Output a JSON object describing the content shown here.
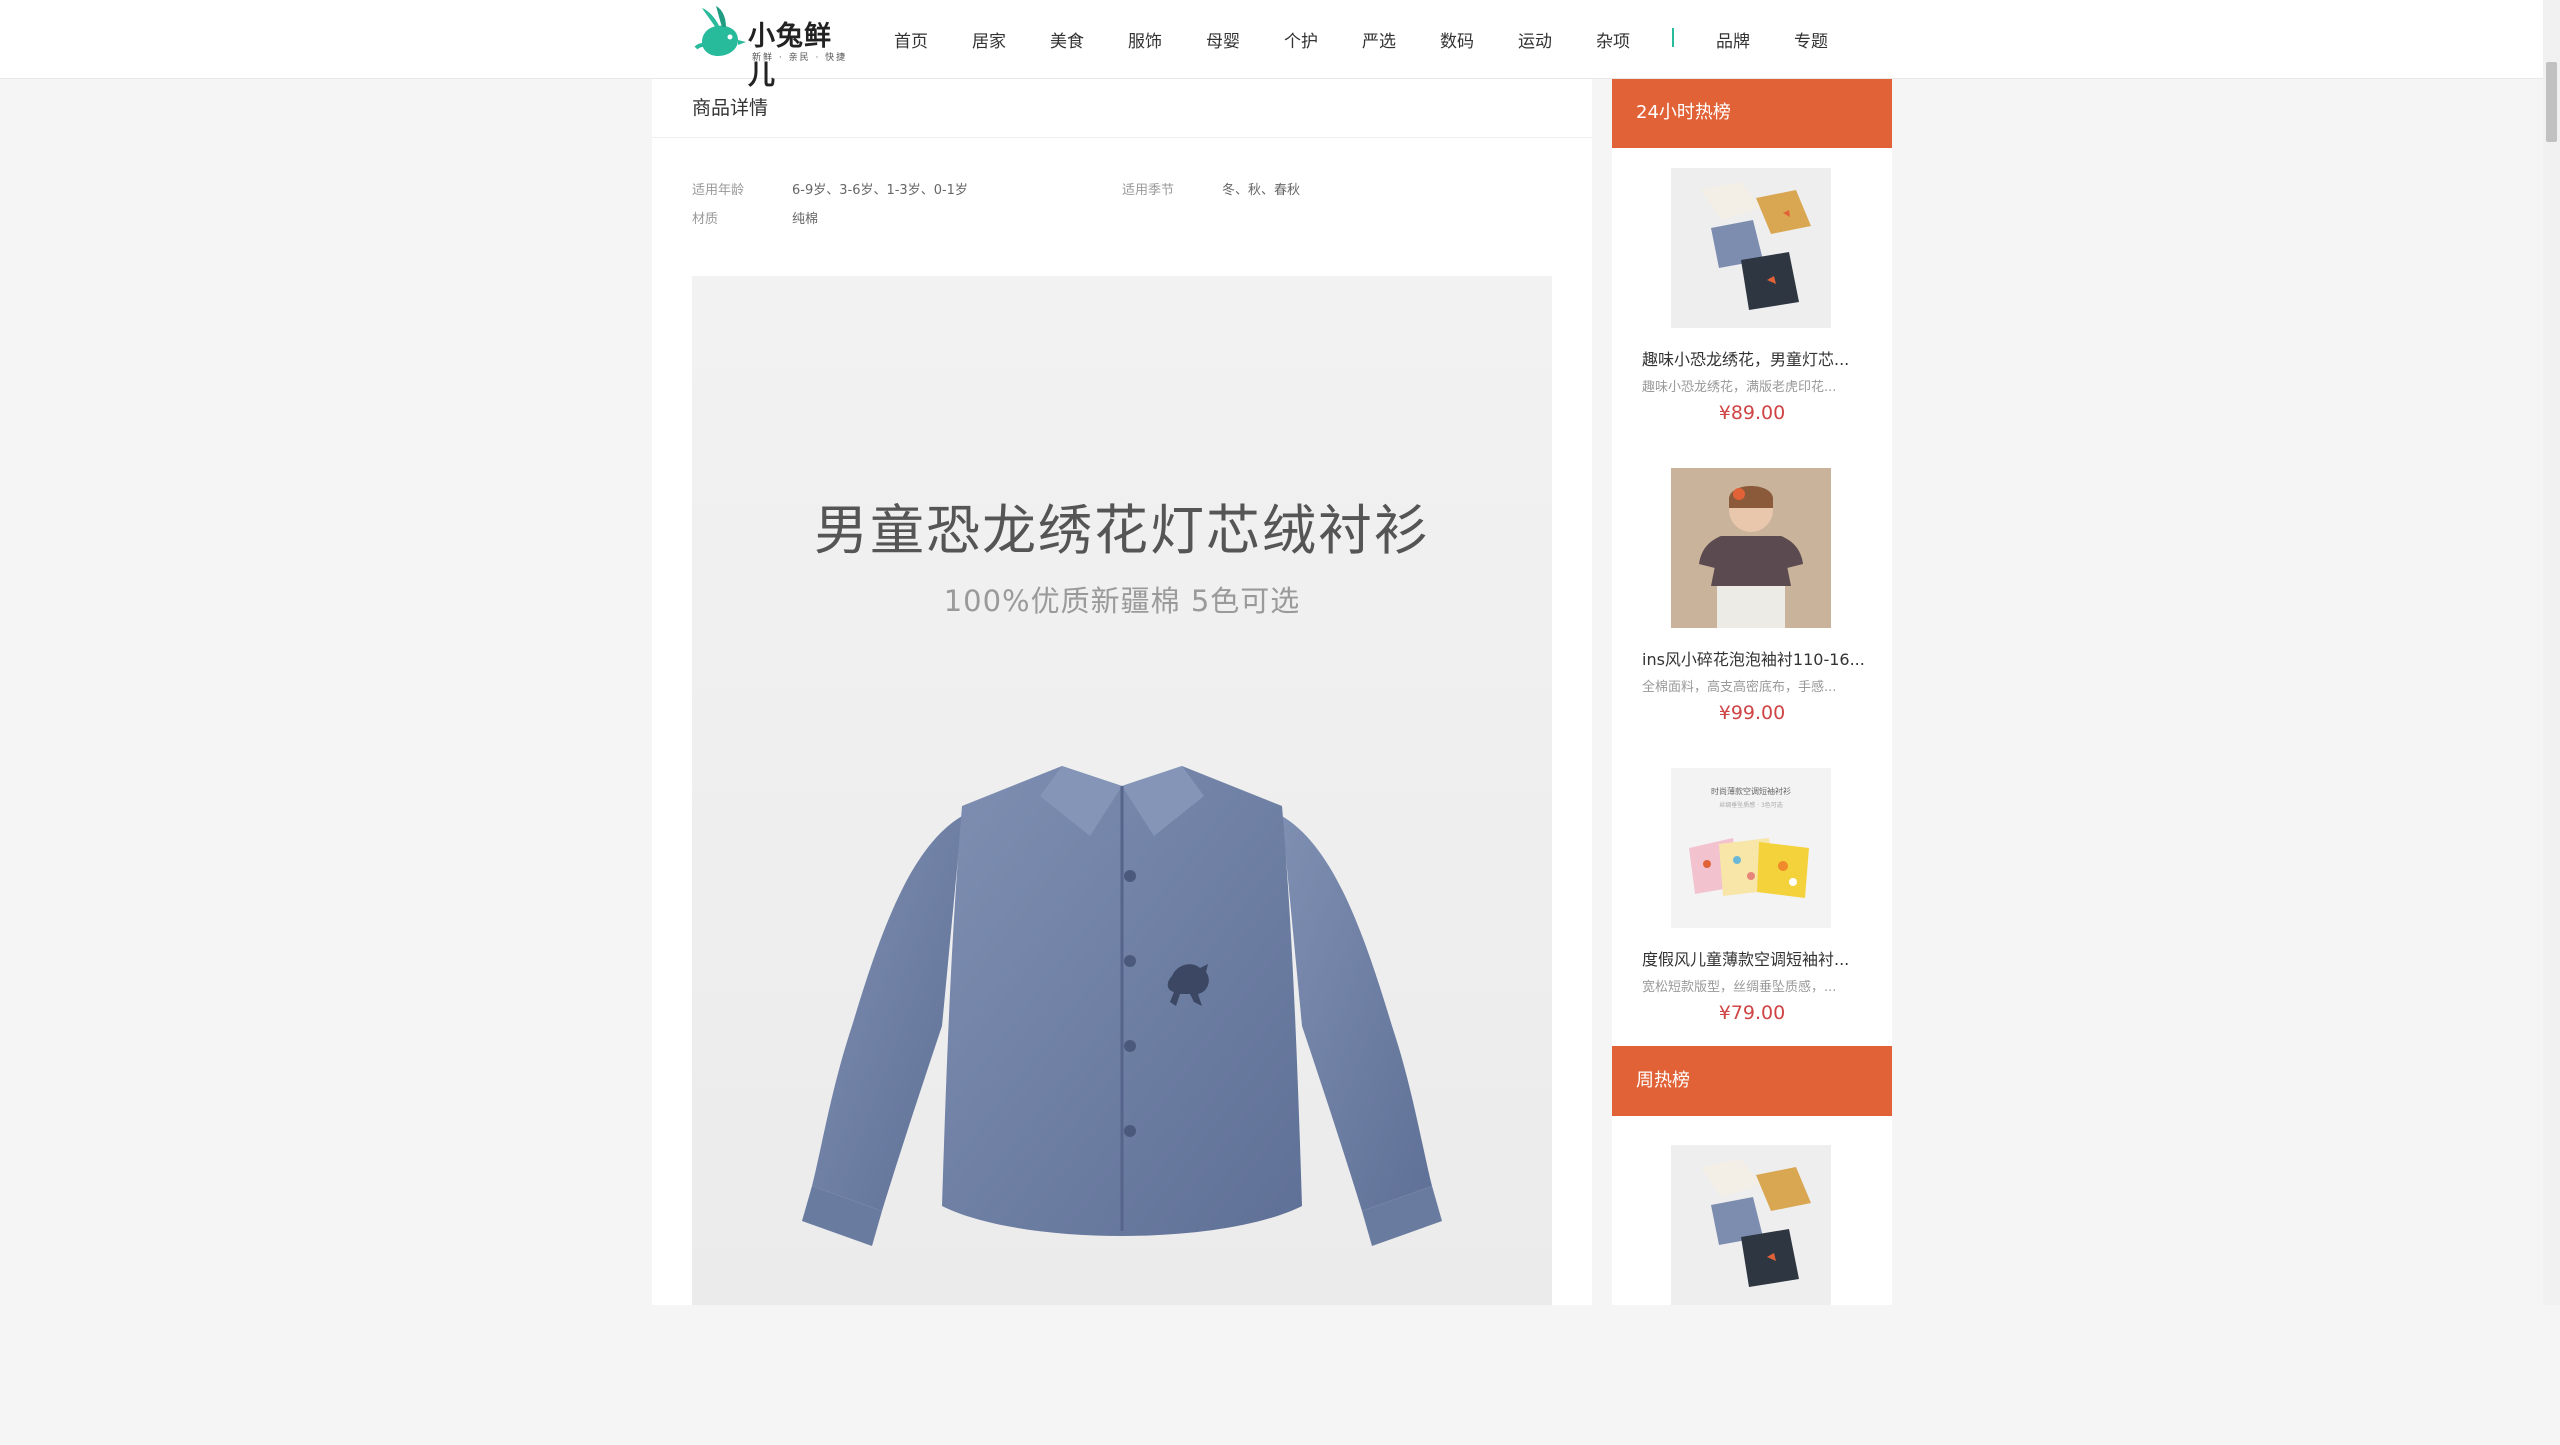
{
  "header": {
    "logo_text": "小兔鲜儿",
    "logo_sub": "新鲜 · 亲民 · 快捷",
    "nav": [
      "首页",
      "居家",
      "美食",
      "服饰",
      "母婴",
      "个护",
      "严选",
      "数码",
      "运动",
      "杂项",
      "品牌",
      "专题"
    ]
  },
  "detail": {
    "title": "商品详情",
    "attributes": [
      {
        "key": "适用年龄",
        "value": "6-9岁、3-6岁、1-3岁、0-1岁"
      },
      {
        "key": "适用季节",
        "value": "冬、秋、春秋"
      },
      {
        "key": "材质",
        "value": "纯棉"
      }
    ],
    "hero_title": "男童恐龙绣花灯芯绒衬衫",
    "hero_subtitle": "100%优质新疆棉 5色可选"
  },
  "sidebar": {
    "hot24_title": "24小时热榜",
    "week_title": "周热榜",
    "hot24_goods": [
      {
        "name": "趣味小恐龙绣花，男童灯芯...",
        "desc": "趣味小恐龙绣花，满版老虎印花...",
        "price": "¥89.00"
      },
      {
        "name": "ins风小碎花泡泡袖衬110-16...",
        "desc": "全棉面料，高支高密底布，手感...",
        "price": "¥99.00"
      },
      {
        "name": "度假风儿童薄款空调短袖衬...",
        "desc": "宽松短款版型，丝绸垂坠质感，...",
        "price": "¥79.00"
      }
    ],
    "thumb3_caption": "时尚薄款空调短袖衬衫",
    "thumb3_subcaption": "丝绸垂坠质感 · 3色可选"
  },
  "colors": {
    "accent_green": "#27ba9b",
    "rank_orange": "#e26237",
    "price_red": "#cf4444"
  }
}
